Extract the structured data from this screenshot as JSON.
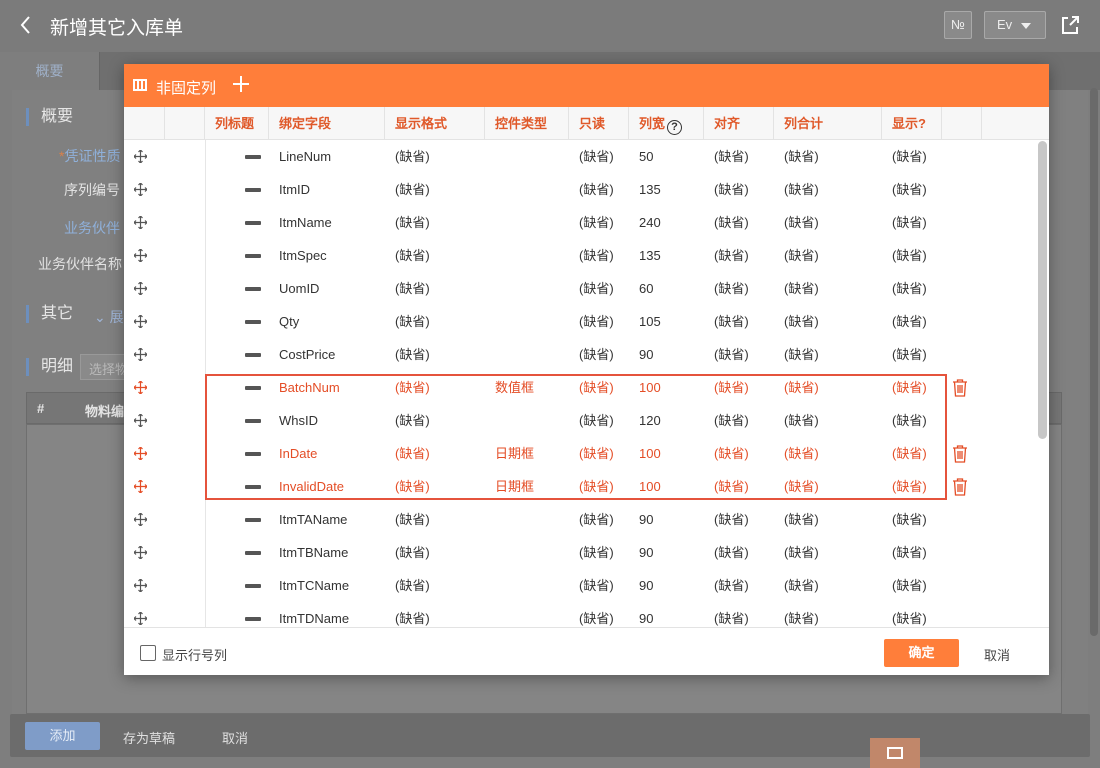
{
  "topbar": {
    "title": "新增其它入库单",
    "no_label": "№",
    "lang": "Ev"
  },
  "tabs": [
    {
      "label": "概要"
    }
  ],
  "background": {
    "section_overview": "概要",
    "field_voucher": "凭证性质",
    "field_serial": "序列编号",
    "field_partner": "业务伙伴",
    "field_partner_name": "业务伙伴名称",
    "section_other": "其它",
    "expand_label": "展",
    "section_detail": "明细",
    "select_placeholder": "选择物",
    "detail_cols": [
      "#",
      "物料编"
    ]
  },
  "bottom": {
    "add": "添加",
    "draft": "存为草稿",
    "cancel": "取消"
  },
  "modal": {
    "title": "非固定列",
    "columns": [
      "列标题",
      "绑定字段",
      "显示格式",
      "控件类型",
      "只读",
      "列宽",
      "对齐",
      "列合计",
      "显示?"
    ],
    "rows": [
      {
        "field": "LineNum",
        "format": "(缺省)",
        "control": "",
        "readonly": "(缺省)",
        "width": "50",
        "align": "(缺省)",
        "total": "(缺省)",
        "show": "(缺省)",
        "highlight": false,
        "deletable": false
      },
      {
        "field": "ItmID",
        "format": "(缺省)",
        "control": "",
        "readonly": "(缺省)",
        "width": "135",
        "align": "(缺省)",
        "total": "(缺省)",
        "show": "(缺省)",
        "highlight": false,
        "deletable": false
      },
      {
        "field": "ItmName",
        "format": "(缺省)",
        "control": "",
        "readonly": "(缺省)",
        "width": "240",
        "align": "(缺省)",
        "total": "(缺省)",
        "show": "(缺省)",
        "highlight": false,
        "deletable": false
      },
      {
        "field": "ItmSpec",
        "format": "(缺省)",
        "control": "",
        "readonly": "(缺省)",
        "width": "135",
        "align": "(缺省)",
        "total": "(缺省)",
        "show": "(缺省)",
        "highlight": false,
        "deletable": false
      },
      {
        "field": "UomID",
        "format": "(缺省)",
        "control": "",
        "readonly": "(缺省)",
        "width": "60",
        "align": "(缺省)",
        "total": "(缺省)",
        "show": "(缺省)",
        "highlight": false,
        "deletable": false
      },
      {
        "field": "Qty",
        "format": "(缺省)",
        "control": "",
        "readonly": "(缺省)",
        "width": "105",
        "align": "(缺省)",
        "total": "(缺省)",
        "show": "(缺省)",
        "highlight": false,
        "deletable": false
      },
      {
        "field": "CostPrice",
        "format": "(缺省)",
        "control": "",
        "readonly": "(缺省)",
        "width": "90",
        "align": "(缺省)",
        "total": "(缺省)",
        "show": "(缺省)",
        "highlight": false,
        "deletable": false
      },
      {
        "field": "BatchNum",
        "format": "(缺省)",
        "control": "数值框",
        "readonly": "(缺省)",
        "width": "100",
        "align": "(缺省)",
        "total": "(缺省)",
        "show": "(缺省)",
        "highlight": true,
        "deletable": true
      },
      {
        "field": "WhsID",
        "format": "(缺省)",
        "control": "",
        "readonly": "(缺省)",
        "width": "120",
        "align": "(缺省)",
        "total": "(缺省)",
        "show": "(缺省)",
        "highlight": false,
        "deletable": false
      },
      {
        "field": "InDate",
        "format": "(缺省)",
        "control": "日期框",
        "readonly": "(缺省)",
        "width": "100",
        "align": "(缺省)",
        "total": "(缺省)",
        "show": "(缺省)",
        "highlight": true,
        "deletable": true
      },
      {
        "field": "InvalidDate",
        "format": "(缺省)",
        "control": "日期框",
        "readonly": "(缺省)",
        "width": "100",
        "align": "(缺省)",
        "total": "(缺省)",
        "show": "(缺省)",
        "highlight": true,
        "deletable": true
      },
      {
        "field": "ItmTAName",
        "format": "(缺省)",
        "control": "",
        "readonly": "(缺省)",
        "width": "90",
        "align": "(缺省)",
        "total": "(缺省)",
        "show": "(缺省)",
        "highlight": false,
        "deletable": false
      },
      {
        "field": "ItmTBName",
        "format": "(缺省)",
        "control": "",
        "readonly": "(缺省)",
        "width": "90",
        "align": "(缺省)",
        "total": "(缺省)",
        "show": "(缺省)",
        "highlight": false,
        "deletable": false
      },
      {
        "field": "ItmTCName",
        "format": "(缺省)",
        "control": "",
        "readonly": "(缺省)",
        "width": "90",
        "align": "(缺省)",
        "total": "(缺省)",
        "show": "(缺省)",
        "highlight": false,
        "deletable": false
      },
      {
        "field": "ItmTDName",
        "format": "(缺省)",
        "control": "",
        "readonly": "(缺省)",
        "width": "90",
        "align": "(缺省)",
        "total": "(缺省)",
        "show": "(缺省)",
        "highlight": false,
        "deletable": false
      }
    ],
    "footer": {
      "checkbox_label": "显示行号列",
      "ok": "确定",
      "cancel": "取消"
    }
  },
  "colors": {
    "accent": "#ff7e3a",
    "highlight": "#e44d26",
    "overlay": "#7e7e7e"
  },
  "icons": [
    "back-icon",
    "share-icon",
    "columns-icon",
    "plus-icon",
    "help-icon",
    "move-icon",
    "drag-handle-icon",
    "trash-icon",
    "checkbox-icon"
  ]
}
